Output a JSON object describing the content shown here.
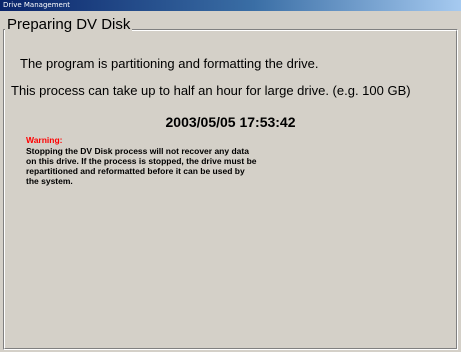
{
  "window": {
    "title": "Drive Management"
  },
  "group": {
    "title": "Preparing DV Disk"
  },
  "content": {
    "status_line": "The program is partitioning and formatting the drive.",
    "duration_line": "This process can take up to half an hour for large drive. (e.g. 100 GB)",
    "datetime": "2003/05/05 17:53:42"
  },
  "warning": {
    "title": "Warning:",
    "lines": [
      "Stopping the DV Disk process will not recover any data",
      "on this drive.  If the process is stopped, the drive must be",
      "repartitioned and reformatted before it can be used by",
      "the system."
    ]
  },
  "colors": {
    "titlebar_start": "#0a246a",
    "titlebar_end": "#a6caf0",
    "background": "#d4d0c8",
    "warning": "#ff0000"
  }
}
